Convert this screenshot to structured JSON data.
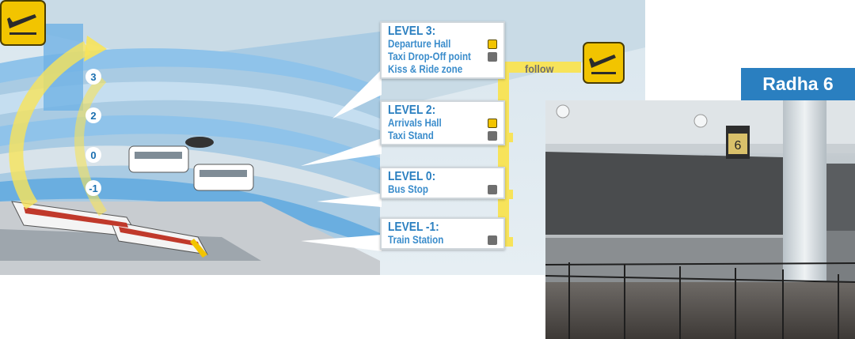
{
  "levels": [
    {
      "heading": "LEVEL 3:",
      "items": [
        {
          "label": "Departure Hall",
          "icon": "departure-plane-icon"
        },
        {
          "label": "Taxi Drop-Off point",
          "icon": "taxi-icon"
        },
        {
          "label": "Kiss & Ride zone",
          "icon": ""
        }
      ]
    },
    {
      "heading": "LEVEL 2:",
      "items": [
        {
          "label": "Arrivals Hall",
          "icon": "arrival-plane-icon"
        },
        {
          "label": "Taxi Stand",
          "icon": "taxi-icon"
        }
      ]
    },
    {
      "heading": "LEVEL 0:",
      "items": [
        {
          "label": "Bus Stop",
          "icon": "bus-icon"
        }
      ]
    },
    {
      "heading": "LEVEL -1:",
      "items": [
        {
          "label": "Train Station",
          "icon": "train-icon"
        }
      ]
    }
  ],
  "floor_numbers": [
    "3",
    "2",
    "0",
    "-1"
  ],
  "follow_label": "follow",
  "photo_title": "Radha 6",
  "check_in_sign": "6",
  "colors": {
    "accent_blue": "#2a7fc0",
    "sign_yellow": "#f2c400",
    "connector_yellow": "#f7e35a",
    "road_blue": "#7ab7e3"
  }
}
